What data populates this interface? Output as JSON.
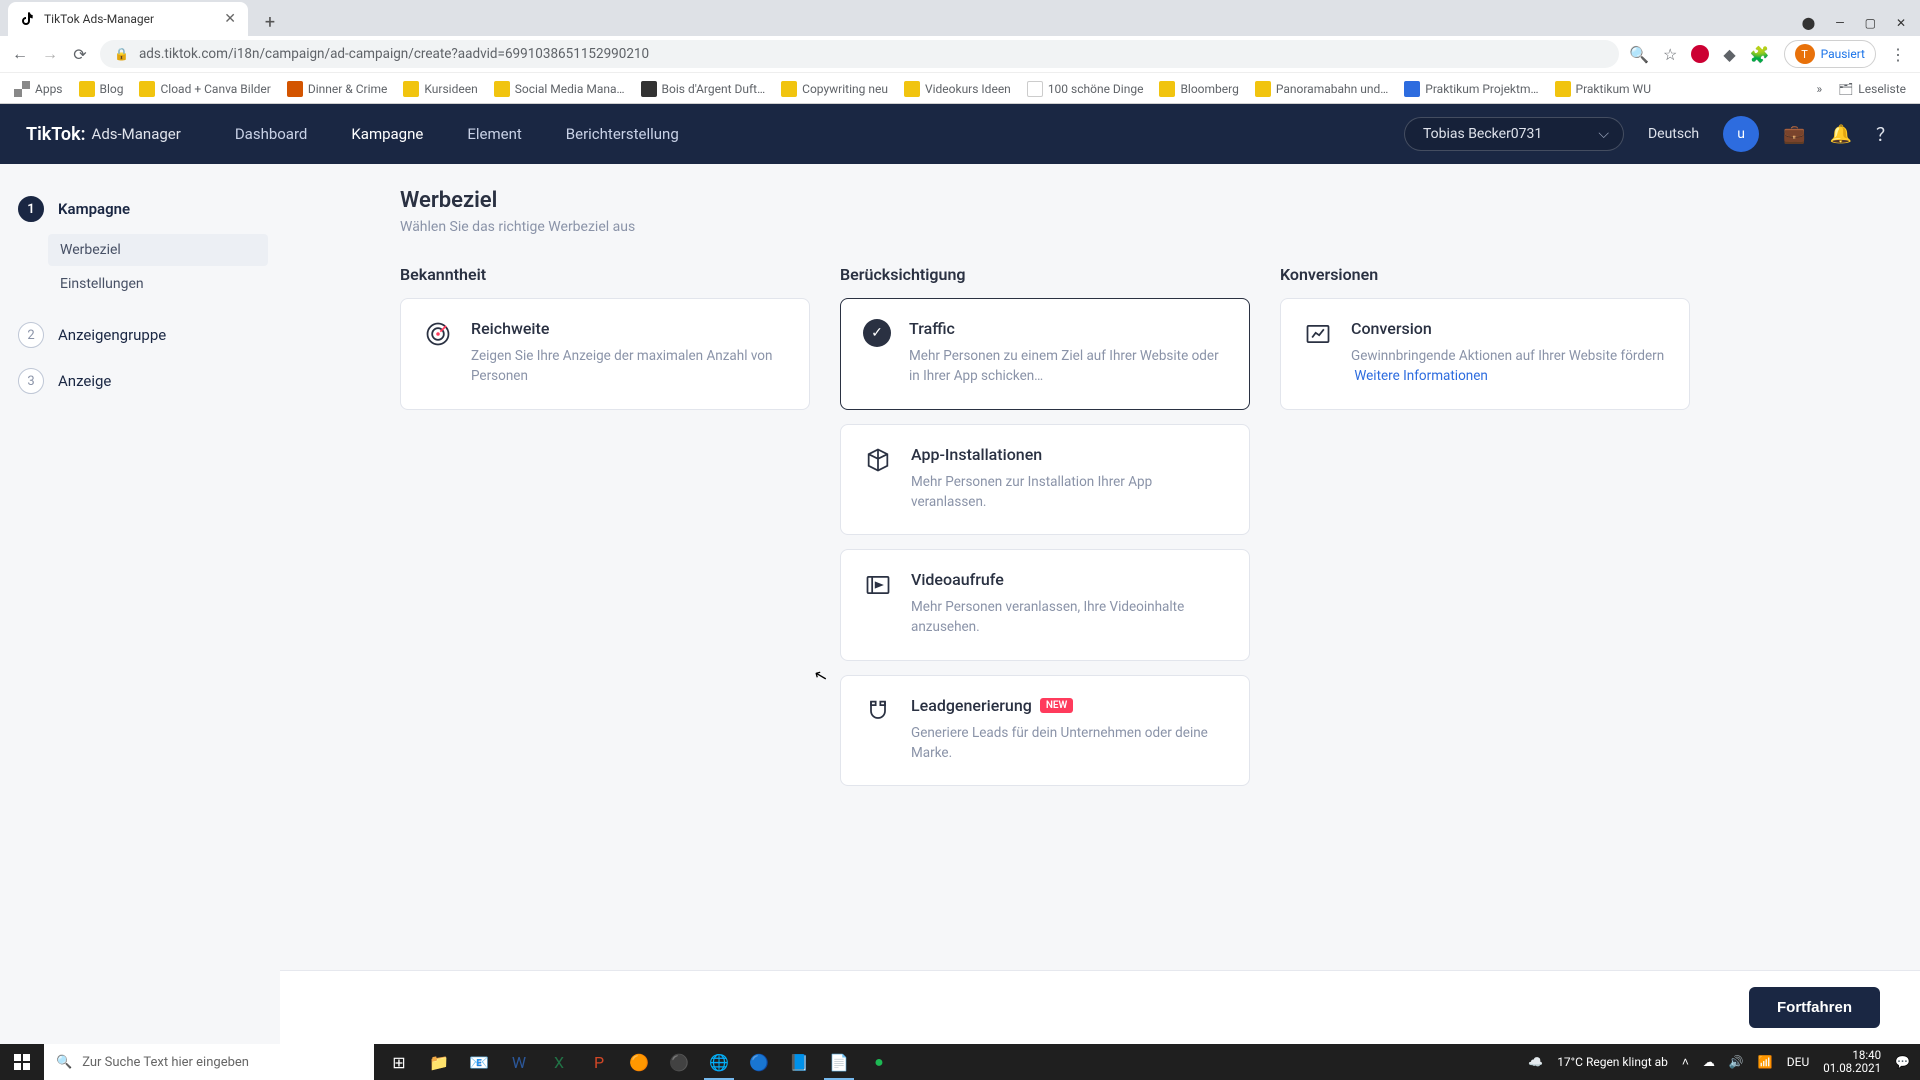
{
  "browser": {
    "tab_title": "TikTok Ads-Manager",
    "url": "ads.tiktok.com/i18n/campaign/ad-campaign/create?aadvid=6991038651152990210",
    "paused_label": "Pausiert",
    "bookmarks": [
      "Apps",
      "Blog",
      "Cload + Canva Bilder",
      "Dinner & Crime",
      "Kursideen",
      "Social Media Mana…",
      "Bois d'Argent Duft…",
      "Copywriting neu",
      "Videokurs Ideen",
      "100 schöne Dinge",
      "Bloomberg",
      "Panoramabahn und…",
      "Praktikum Projektm…",
      "Praktikum WU"
    ],
    "overflow": "»",
    "readinglist": "Leseliste"
  },
  "header": {
    "logo_main": "TikTok:",
    "logo_sub": "Ads-Manager",
    "nav": [
      "Dashboard",
      "Kampagne",
      "Element",
      "Berichterstellung"
    ],
    "account": "Tobias Becker0731",
    "language": "Deutsch",
    "avatar_letter": "u"
  },
  "steps": {
    "items": [
      {
        "num": "1",
        "label": "Kampagne",
        "sub": [
          {
            "label": "Werbeziel",
            "sel": true
          },
          {
            "label": "Einstellungen",
            "sel": false
          }
        ]
      },
      {
        "num": "2",
        "label": "Anzeigengruppe"
      },
      {
        "num": "3",
        "label": "Anzeige"
      }
    ]
  },
  "page": {
    "title": "Werbeziel",
    "subtitle": "Wählen Sie das richtige Werbeziel aus",
    "columns": [
      {
        "head": "Bekanntheit",
        "cards": [
          {
            "id": "reach",
            "title": "Reichweite",
            "desc": "Zeigen Sie Ihre Anzeige der maximalen Anzahl von Personen"
          }
        ]
      },
      {
        "head": "Berücksichtigung",
        "cards": [
          {
            "id": "traffic",
            "title": "Traffic",
            "desc": "Mehr Personen zu einem Ziel auf Ihrer Website oder in Ihrer App schicken…",
            "selected": true
          },
          {
            "id": "app",
            "title": "App-Installationen",
            "desc": "Mehr Personen zur Installation Ihrer App veranlassen."
          },
          {
            "id": "video",
            "title": "Videoaufrufe",
            "desc": "Mehr Personen veranlassen, Ihre Videoinhalte anzusehen."
          },
          {
            "id": "lead",
            "title": "Leadgenerierung",
            "desc": "Generiere Leads für dein Unternehmen oder deine Marke.",
            "badge": "NEW"
          }
        ]
      },
      {
        "head": "Konversionen",
        "cards": [
          {
            "id": "conversion",
            "title": "Conversion",
            "desc": "Gewinnbringende Aktionen auf Ihrer Website fördern",
            "link": "Weitere Informationen"
          }
        ]
      }
    ],
    "continue": "Fortfahren"
  },
  "taskbar": {
    "search_placeholder": "Zur Suche Text hier eingeben",
    "weather": "17°C  Regen klingt ab",
    "time": "18:40",
    "date": "01.08.2021"
  }
}
